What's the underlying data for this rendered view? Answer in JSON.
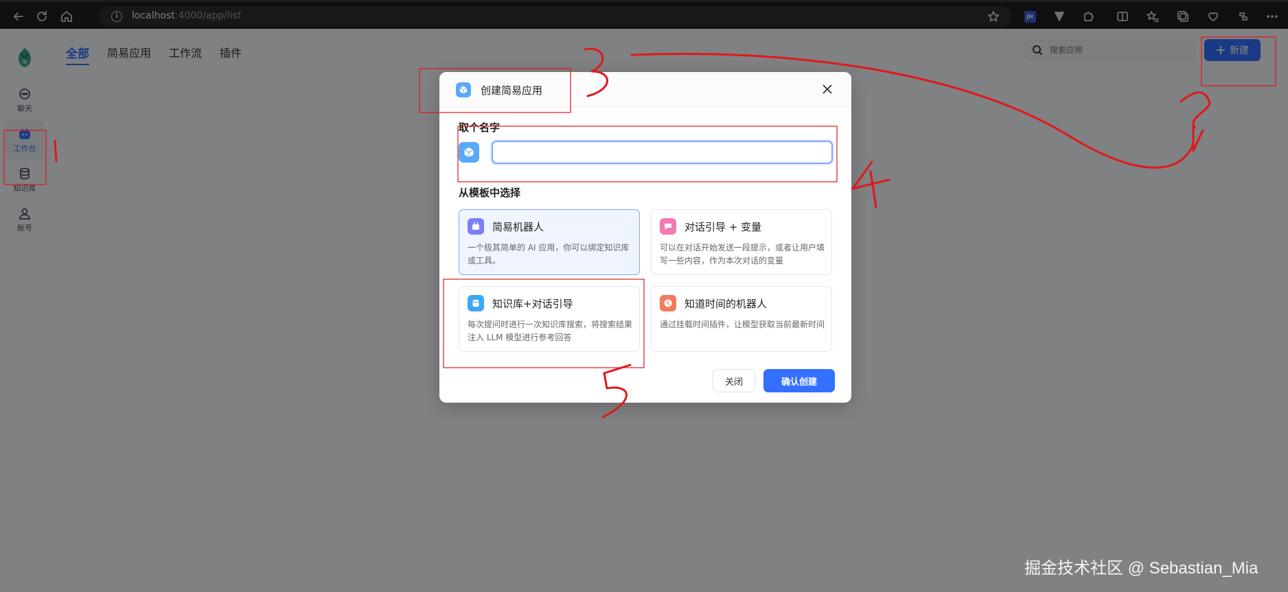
{
  "browser": {
    "url_host": "localhost",
    "url_path": ":4000/app/list",
    "ext_badge": "JH"
  },
  "sidebar": {
    "items": [
      {
        "label": "聊天",
        "icon": "chat-icon"
      },
      {
        "label": "工作台",
        "icon": "robot-icon",
        "active": true
      },
      {
        "label": "知识库",
        "icon": "database-icon"
      },
      {
        "label": "账号",
        "icon": "user-icon"
      }
    ]
  },
  "tabs": [
    {
      "label": "全部",
      "active": true
    },
    {
      "label": "简易应用"
    },
    {
      "label": "工作流"
    },
    {
      "label": "插件"
    }
  ],
  "search": {
    "placeholder": "搜索应用"
  },
  "new_button": {
    "label": "新建",
    "icon": "plus-icon"
  },
  "modal": {
    "title": "创建简易应用",
    "name_label": "取个名字",
    "name_value": "",
    "template_label": "从模板中选择",
    "templates": [
      {
        "title": "简易机器人",
        "desc": "一个极其简单的 AI 应用，你可以绑定知识库或工具。",
        "color": "#7b7ff7",
        "icon": "robot-icon",
        "selected": true
      },
      {
        "title": "对话引导 + 变量",
        "desc": "可以在对话开始发送一段提示，或者让用户填写一些内容，作为本次对话的变量",
        "color": "#f47ab0",
        "icon": "chat-guide-icon"
      },
      {
        "title": "知识库+对话引导",
        "desc": "每次提问时进行一次知识库搜索，将搜索结果注入 LLM 模型进行参考回答",
        "color": "#3ca8f5",
        "icon": "database-icon"
      },
      {
        "title": "知道时间的机器人",
        "desc": "通过挂载时间插件，让模型获取当前最新时间",
        "color": "#f27b5d",
        "icon": "clock-icon"
      }
    ],
    "close_label": "关闭",
    "confirm_label": "确认创建"
  },
  "annotation_color": "#e0181c",
  "annotations": [
    "1",
    "3",
    "4",
    "5"
  ],
  "watermark": "掘金技术社区 @ Sebastian_Mia"
}
